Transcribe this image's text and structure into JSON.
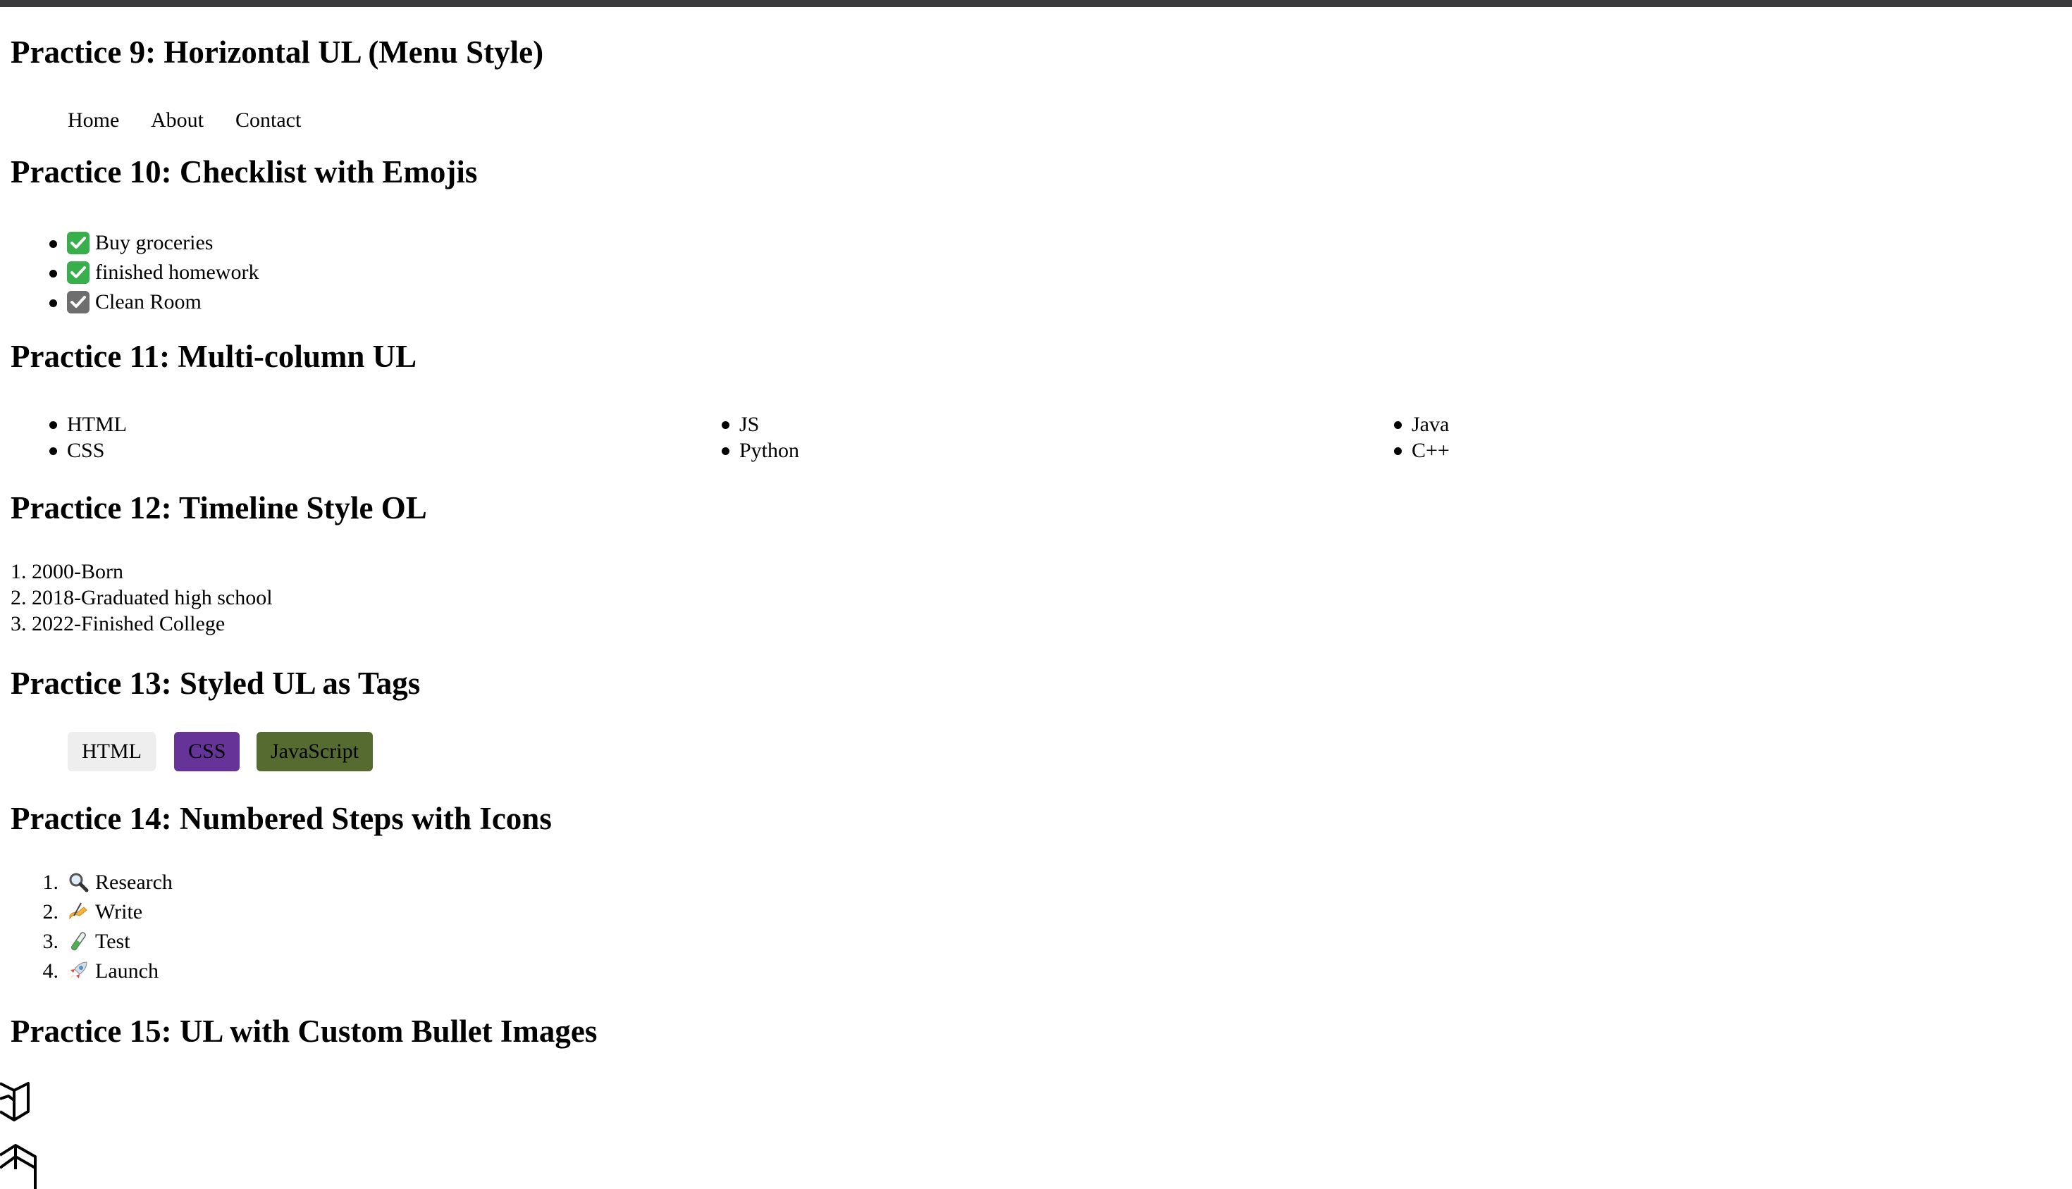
{
  "practice9": {
    "heading": "Practice 9: Horizontal UL (Menu Style)",
    "menu": [
      "Home",
      "About",
      "Contact"
    ]
  },
  "practice10": {
    "heading": "Practice 10: Checklist with Emojis",
    "items": [
      {
        "icon": "check-mark-green-icon",
        "text": "Buy groceries"
      },
      {
        "icon": "check-mark-green-icon",
        "text": "finished homework"
      },
      {
        "icon": "check-box-gray-icon",
        "text": "Clean Room"
      }
    ]
  },
  "practice11": {
    "heading": "Practice 11: Multi-column UL",
    "items": [
      "HTML",
      "CSS",
      "JS",
      "Python",
      "Java",
      "C++"
    ]
  },
  "practice12": {
    "heading": "Practice 12: Timeline Style OL",
    "items": [
      "1. 2000-Born",
      "2. 2018-Graduated high school",
      "3. 2022-Finished College"
    ]
  },
  "practice13": {
    "heading": "Practice 13: Styled UL as Tags",
    "tags": [
      {
        "text": "HTML",
        "bg": "#eeeeee"
      },
      {
        "text": "CSS",
        "bg": "#663399"
      },
      {
        "text": "JavaScript",
        "bg": "#556b2f"
      }
    ]
  },
  "practice14": {
    "heading": "Practice 14: Numbered Steps with Icons",
    "steps": [
      {
        "num": "1.",
        "icon": "magnifier-icon",
        "text": "Research"
      },
      {
        "num": "2.",
        "icon": "writing-hand-icon",
        "text": "Write"
      },
      {
        "num": "3.",
        "icon": "test-tube-icon",
        "text": "Test"
      },
      {
        "num": "4.",
        "icon": "rocket-icon",
        "text": "Launch"
      }
    ]
  },
  "practice15": {
    "heading": "Practice 15: UL with Custom Bullet Images",
    "bullet_icon": "cube-outline-icon"
  }
}
